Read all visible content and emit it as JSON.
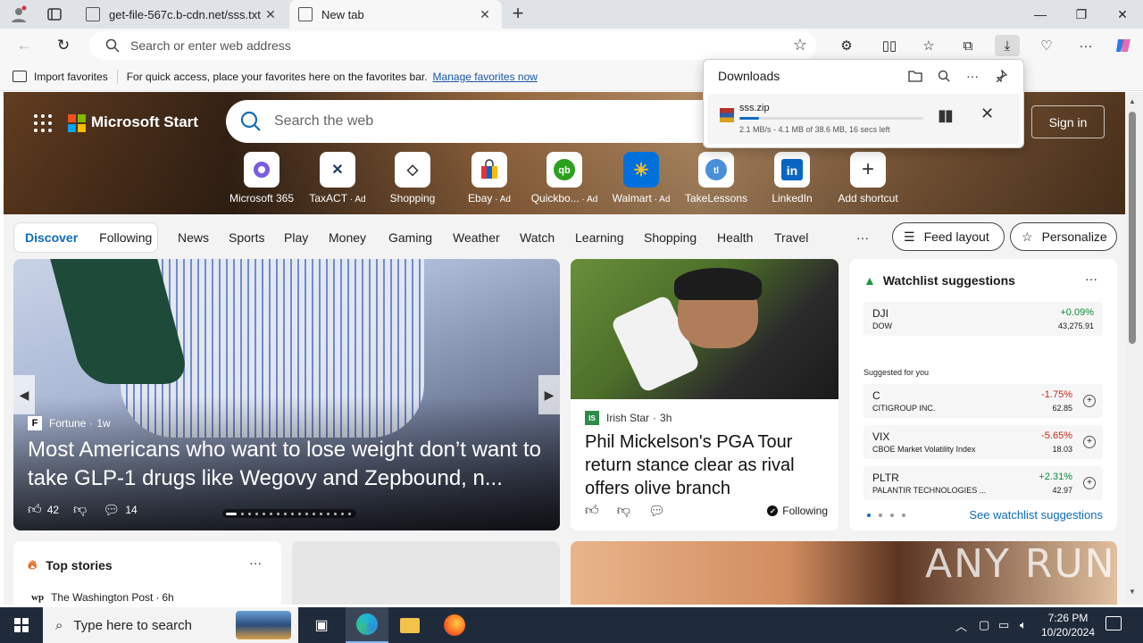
{
  "browser": {
    "tabs": [
      {
        "title": "get-file-567c.b-cdn.net/sss.txt"
      },
      {
        "title": "New tab"
      }
    ],
    "address_placeholder": "Search or enter web address",
    "favorites_bar": {
      "import_label": "Import favorites",
      "hint": "For quick access, place your favorites here on the favorites bar.",
      "manage_link": "Manage favorites now"
    },
    "downloads": {
      "title": "Downloads",
      "file_name": "sss.zip",
      "status": "2.1 MB/s - 4.1 MB of 38.6 MB, 16 secs left",
      "progress_fraction": 0.106
    }
  },
  "msn": {
    "brand": "Microsoft Start",
    "search_placeholder": "Search the web",
    "sign_in": "Sign in",
    "shortcuts": [
      {
        "label": "Microsoft 365",
        "ad": ""
      },
      {
        "label": "TaxACT",
        "ad": "Ad"
      },
      {
        "label": "Shopping",
        "ad": ""
      },
      {
        "label": "Ebay",
        "ad": "Ad"
      },
      {
        "label": "Quickbo...",
        "ad": "Ad"
      },
      {
        "label": "Walmart",
        "ad": "Ad"
      },
      {
        "label": "TakeLessons",
        "ad": ""
      },
      {
        "label": "LinkedIn",
        "ad": ""
      },
      {
        "label": "Add shortcut",
        "ad": ""
      }
    ],
    "segments": [
      "Discover",
      "Following"
    ],
    "nav": [
      "News",
      "Sports",
      "Play",
      "Money",
      "Gaming",
      "Weather",
      "Watch",
      "Learning",
      "Shopping",
      "Health",
      "Travel"
    ],
    "more": "···",
    "feed_layout": "Feed layout",
    "personalize": "Personalize",
    "hero": {
      "source": "Fortune",
      "age": "1w",
      "title": "Most Americans who want to lose weight don’t want to take GLP-1 drugs like Wegovy and Zepbound, n...",
      "likes": "42",
      "comments": "14"
    },
    "story2": {
      "source": "Irish Star",
      "age": "3h",
      "title": "Phil Mickelson's PGA Tour return stance clear as rival offers olive branch",
      "following": "Following"
    },
    "watchlist": {
      "title": "Watchlist suggestions",
      "more": "···",
      "index": {
        "symbol": "DJI",
        "name": "DOW",
        "change": "+0.09%",
        "price": "43,275.91"
      },
      "suggested_label": "Suggested for you",
      "stocks": [
        {
          "symbol": "C",
          "name": "CITIGROUP INC.",
          "change": "-1.75%",
          "price": "62.85"
        },
        {
          "symbol": "VIX",
          "name": "CBOE Market Volatility Index",
          "change": "-5.65%",
          "price": "18.03"
        },
        {
          "symbol": "PLTR",
          "name": "PALANTIR TECHNOLOGIES ...",
          "change": "+2.31%",
          "price": "42.97"
        }
      ],
      "see_link": "See watchlist suggestions"
    },
    "top_stories": {
      "title": "Top stories",
      "more": "···",
      "source": "The Washington Post",
      "source_logo": "wp",
      "age": "6h"
    },
    "watermark": "ANY RUN"
  },
  "taskbar": {
    "search_placeholder": "Type here to search",
    "time": "7:26 PM",
    "date": "10/20/2024"
  }
}
